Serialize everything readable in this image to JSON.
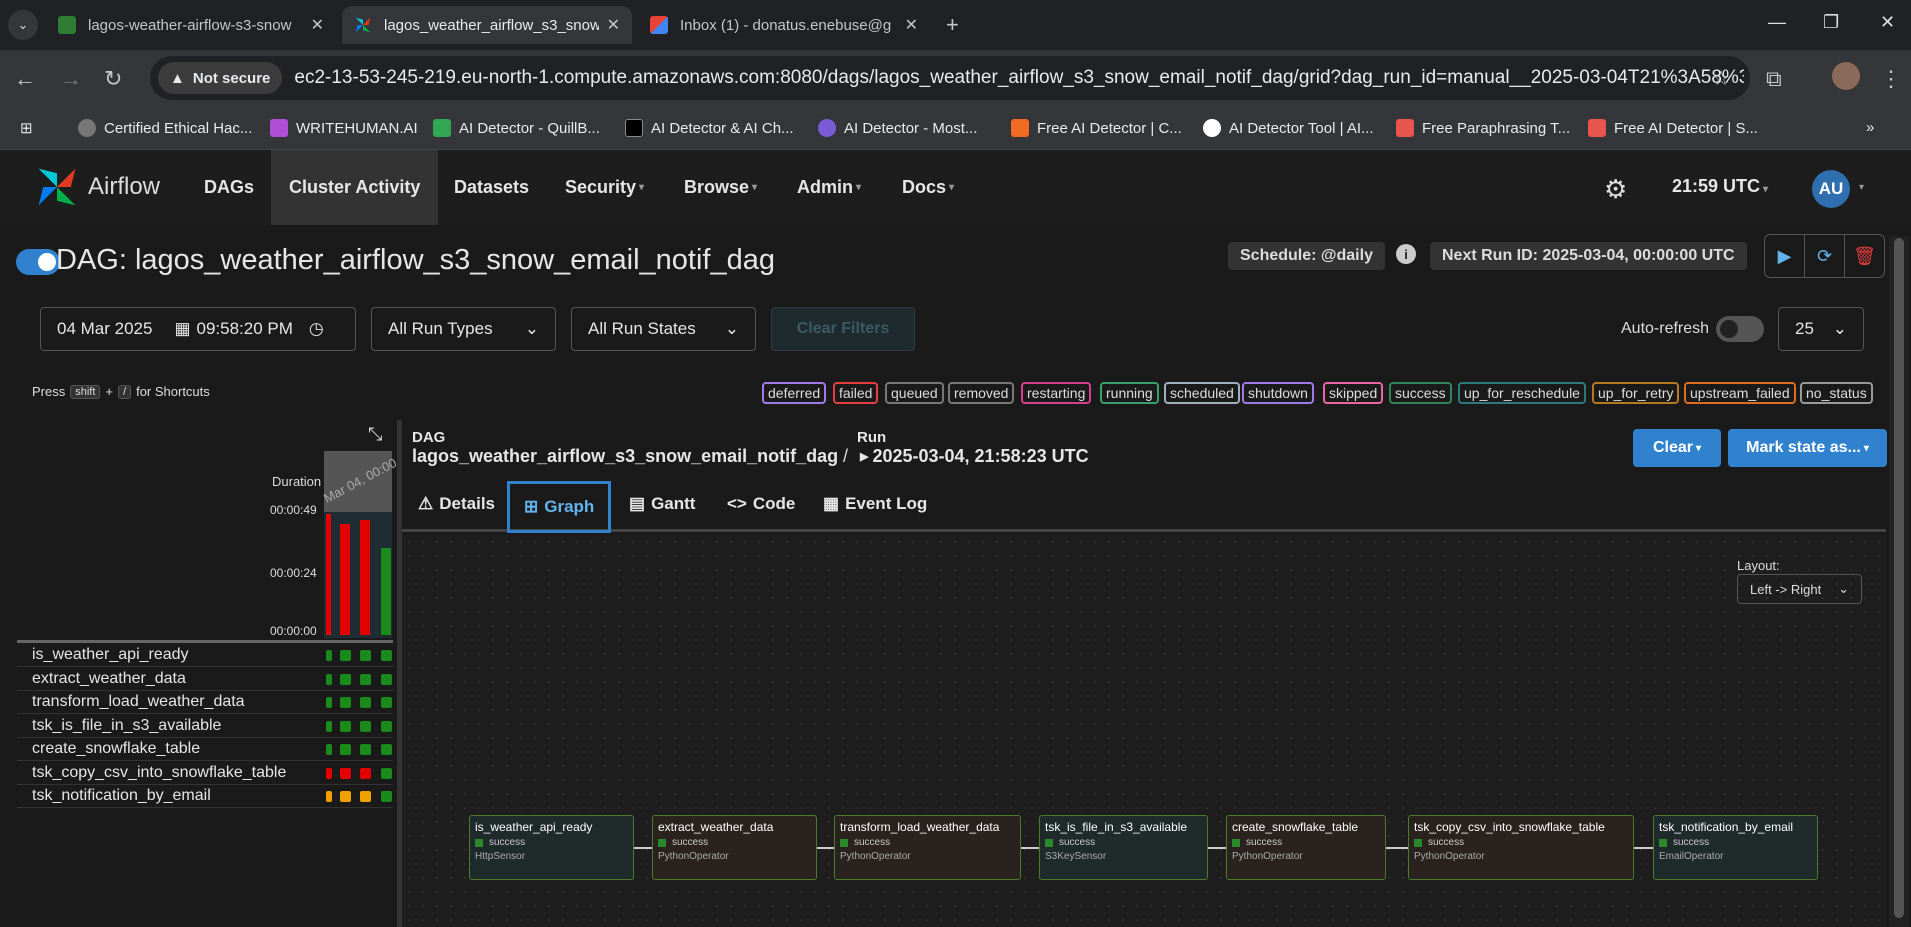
{
  "browser": {
    "tabs": [
      {
        "title": "lagos-weather-airflow-s3-snow",
        "icon": "airflow-green-icon",
        "active": false
      },
      {
        "title": "lagos_weather_airflow_s3_snow",
        "icon": "airflow-pinwheel-icon",
        "active": true
      },
      {
        "title": "Inbox (1) - donatus.enebuse@g",
        "icon": "gmail-icon",
        "active": false
      }
    ],
    "security_label": "Not secure",
    "url": "ec2-13-53-245-219.eu-north-1.compute.amazonaws.com:8080/dags/lagos_weather_airflow_s3_snow_email_notif_dag/grid?dag_run_id=manual__2025-03-04T21%3A58%3A23.80226...",
    "bookmarks": [
      "Certified Ethical Hac...",
      "WRITEHUMAN.AI",
      "AI Detector - QuillB...",
      "AI Detector & AI Ch...",
      "AI Detector - Most...",
      "Free AI Detector | C...",
      "AI Detector Tool | AI...",
      "Free Paraphrasing T...",
      "Free AI Detector | S..."
    ]
  },
  "airflow_nav": {
    "brand": "Airflow",
    "menu": [
      "DAGs",
      "Cluster Activity",
      "Datasets",
      "Security",
      "Browse",
      "Admin",
      "Docs"
    ],
    "time": "21:59 UTC",
    "avatar": "AU"
  },
  "dag": {
    "title": "DAG: lagos_weather_airflow_s3_snow_email_notif_dag",
    "schedule": "Schedule: @daily",
    "next_run": "Next Run ID: 2025-03-04, 00:00:00 UTC"
  },
  "filters": {
    "date": "04 Mar 2025",
    "time": "09:58:20 PM",
    "run_types": "All Run Types",
    "run_states": "All Run States",
    "clear": "Clear Filters",
    "auto_refresh": "Auto-refresh",
    "page_size": "25"
  },
  "shortcuts": {
    "press": "Press",
    "key1": "shift",
    "plus": "+",
    "key2": "/",
    "suffix": "for Shortcuts"
  },
  "legend": [
    {
      "label": "deferred",
      "color": "#9f7aea"
    },
    {
      "label": "failed",
      "color": "#e53e3e"
    },
    {
      "label": "queued",
      "color": "#777777"
    },
    {
      "label": "removed",
      "color": "#777777"
    },
    {
      "label": "restarting",
      "color": "#d53f8c"
    },
    {
      "label": "running",
      "color": "#38a169"
    },
    {
      "label": "scheduled",
      "color": "#a0aec0"
    },
    {
      "label": "shutdown",
      "color": "#9f7aea"
    },
    {
      "label": "skipped",
      "color": "#ed64a6"
    },
    {
      "label": "success",
      "color": "#2f855a"
    },
    {
      "label": "up_for_reschedule",
      "color": "#2c7a7b"
    },
    {
      "label": "up_for_retry",
      "color": "#b7791f"
    },
    {
      "label": "upstream_failed",
      "color": "#dd6b20"
    },
    {
      "label": "no_status",
      "color": "#999999"
    }
  ],
  "grid": {
    "duration_label": "Duration",
    "ticks": [
      "00:00:49",
      "00:00:24",
      "00:00:00"
    ],
    "run_header": "Mar 04, 00:00",
    "runs": [
      {
        "duration_fraction": 1.0,
        "color": "#e30000"
      },
      {
        "duration_fraction": 0.92,
        "color": "#e30000"
      },
      {
        "duration_fraction": 0.95,
        "color": "#e30000"
      },
      {
        "duration_fraction": 0.72,
        "color": "#1a8a1a"
      }
    ],
    "tasks": [
      {
        "name": "is_weather_api_ready",
        "states": [
          "#1a8a1a",
          "#1a8a1a",
          "#1a8a1a",
          "#1a8a1a"
        ]
      },
      {
        "name": "extract_weather_data",
        "states": [
          "#1a8a1a",
          "#1a8a1a",
          "#1a8a1a",
          "#1a8a1a"
        ]
      },
      {
        "name": "transform_load_weather_data",
        "states": [
          "#1a8a1a",
          "#1a8a1a",
          "#1a8a1a",
          "#1a8a1a"
        ]
      },
      {
        "name": "tsk_is_file_in_s3_available",
        "states": [
          "#1a8a1a",
          "#1a8a1a",
          "#1a8a1a",
          "#1a8a1a"
        ]
      },
      {
        "name": "create_snowflake_table",
        "states": [
          "#1a8a1a",
          "#1a8a1a",
          "#1a8a1a",
          "#1a8a1a"
        ]
      },
      {
        "name": "tsk_copy_csv_into_snowflake_table",
        "states": [
          "#e30000",
          "#e30000",
          "#e30000",
          "#1a8a1a"
        ]
      },
      {
        "name": "tsk_notification_by_email",
        "states": [
          "#f0a000",
          "#f0a000",
          "#f0a000",
          "#1a8a1a"
        ]
      }
    ]
  },
  "breadcrumb": {
    "dag_label": "DAG",
    "dag_name": "lagos_weather_airflow_s3_snow_email_notif_dag",
    "sep": "/",
    "run_label": "Run",
    "run_value": "2025-03-04, 21:58:23 UTC"
  },
  "actions": {
    "clear": "Clear",
    "mark": "Mark state as..."
  },
  "detail_tabs": [
    "Details",
    "Graph",
    "Gantt",
    "Code",
    "Event Log"
  ],
  "graph": {
    "layout_label": "Layout:",
    "layout_value": "Left -> Right",
    "nodes": [
      {
        "name": "is_weather_api_ready",
        "state": "success",
        "operator": "HttpSensor"
      },
      {
        "name": "extract_weather_data",
        "state": "success",
        "operator": "PythonOperator"
      },
      {
        "name": "transform_load_weather_data",
        "state": "success",
        "operator": "PythonOperator"
      },
      {
        "name": "tsk_is_file_in_s3_available",
        "state": "success",
        "operator": "S3KeySensor"
      },
      {
        "name": "create_snowflake_table",
        "state": "success",
        "operator": "PythonOperator"
      },
      {
        "name": "tsk_copy_csv_into_snowflake_table",
        "state": "success",
        "operator": "PythonOperator"
      },
      {
        "name": "tsk_notification_by_email",
        "state": "success",
        "operator": "EmailOperator"
      }
    ]
  }
}
